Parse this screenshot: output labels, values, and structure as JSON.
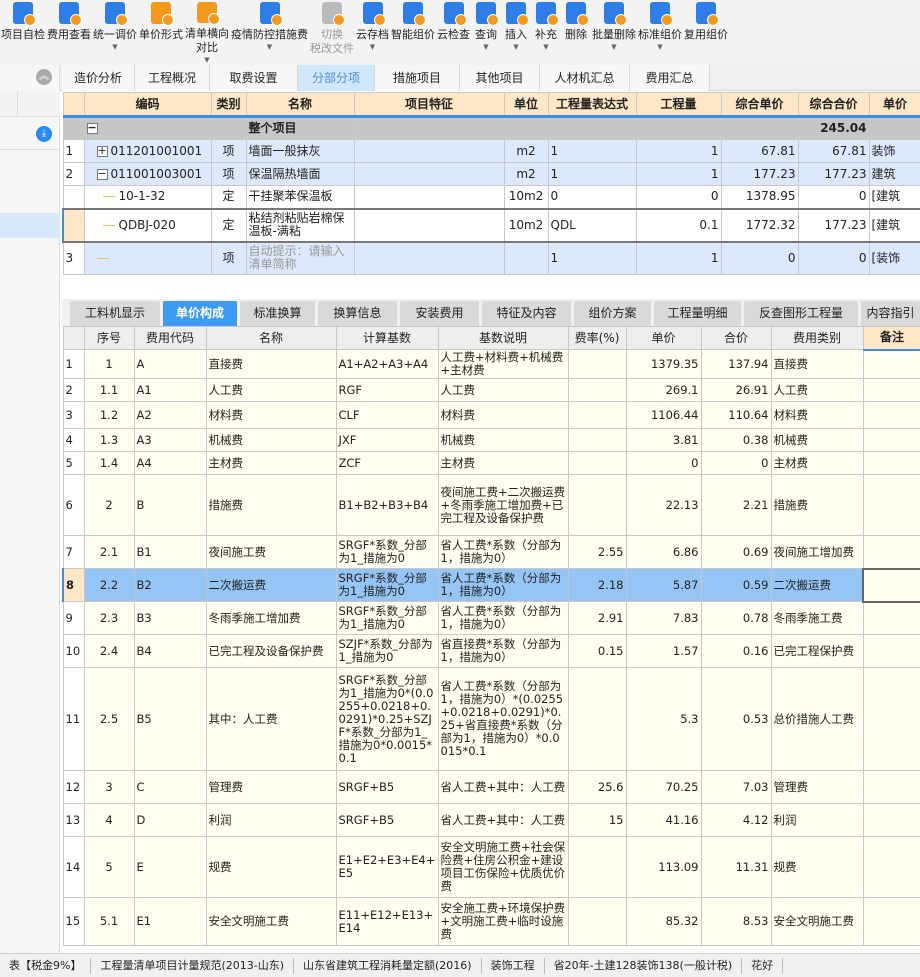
{
  "toolbar": [
    {
      "label": "项目自检",
      "icon": "check-doc-icon",
      "color": "#2f7ee8"
    },
    {
      "label": "费用查看",
      "icon": "fee-view-icon",
      "color": "#2f7ee8"
    },
    {
      "label": "统一调价",
      "icon": "adjust-price-icon",
      "color": "#2f7ee8",
      "dropdown": true
    },
    {
      "label": "单价形式",
      "icon": "price-form-icon",
      "color": "#f39a1e"
    },
    {
      "label": "清单横向",
      "label2": "对比",
      "icon": "compare-icon",
      "color": "#f39a1e",
      "dropdown": true
    },
    {
      "label": "疫情防控措施费",
      "icon": "epidemic-fee-icon",
      "color": "#2f7ee8",
      "dropdown": true
    },
    {
      "label": "切换",
      "label2": "税改文件",
      "icon": "switch-tax-icon",
      "color": "#bbbbbb",
      "disabled": true
    },
    {
      "label": "云存档",
      "icon": "cloud-upload-icon",
      "color": "#2f7ee8",
      "dropdown": true
    },
    {
      "label": "智能组价",
      "icon": "smart-price-icon",
      "color": "#2f7ee8"
    },
    {
      "label": "云检查",
      "icon": "cloud-check-icon",
      "color": "#2f7ee8"
    },
    {
      "label": "查询",
      "icon": "search-icon",
      "color": "#2f7ee8",
      "dropdown": true
    },
    {
      "label": "插入",
      "icon": "insert-icon",
      "color": "#2f7ee8",
      "dropdown": true
    },
    {
      "label": "补充",
      "icon": "add-icon",
      "color": "#2f7ee8",
      "dropdown": true
    },
    {
      "label": "删除",
      "icon": "trash-icon",
      "color": "#2f7ee8"
    },
    {
      "label": "批量删除",
      "icon": "batch-delete-icon",
      "color": "#2f7ee8",
      "dropdown": true
    },
    {
      "label": "标准组价",
      "icon": "standard-price-icon",
      "color": "#2f7ee8",
      "dropdown": true
    },
    {
      "label": "复用组价",
      "icon": "reuse-price-icon",
      "color": "#2f7ee8"
    }
  ],
  "main_tabs": [
    "造价分析",
    "工程概况",
    "取费设置",
    "分部分项",
    "措施项目",
    "其他项目",
    "人材机汇总",
    "费用汇总"
  ],
  "main_active": "分部分项",
  "upper": {
    "headers": [
      "编码",
      "类别",
      "名称",
      "项目特征",
      "单位",
      "工程量表达式",
      "工程量",
      "综合单价",
      "综合合价",
      "单价"
    ],
    "group": {
      "label": "整个项目",
      "total": "245.04"
    },
    "rows": [
      {
        "rn": "1",
        "code": "011201001001",
        "type": "项",
        "name": "墙面一般抹灰",
        "feature": "",
        "unit": "m2",
        "expr": "1",
        "qty": "1",
        "uprice": "67.81",
        "total": "67.81",
        "extra": "装饰",
        "box": "+"
      },
      {
        "rn": "2",
        "code": "011001003001",
        "type": "项",
        "name": "保温隔热墙面",
        "feature": "",
        "unit": "m2",
        "expr": "1",
        "qty": "1",
        "uprice": "177.23",
        "total": "177.23",
        "extra": "建筑",
        "box": "−"
      },
      {
        "rn": "",
        "code": "10-1-32",
        "type": "定",
        "name": "干挂聚苯保温板",
        "feature": "",
        "unit": "10m2",
        "expr": "0",
        "qty": "0",
        "uprice": "1378.95",
        "total": "0",
        "extra": "[建筑",
        "sub": true
      },
      {
        "rn": "",
        "code": "QDBJ-020",
        "type": "定",
        "name": "粘结剂粘贴岩棉保温板-满粘",
        "feature": "",
        "unit": "10m2",
        "expr": "QDL",
        "qty": "0.1",
        "uprice": "1772.32",
        "total": "177.23",
        "extra": "[建筑",
        "sub": true,
        "sel": true
      },
      {
        "rn": "3",
        "code": "",
        "type": "项",
        "name": "自动提示：请输入清单简称",
        "feature": "",
        "unit": "",
        "expr": "1",
        "qty": "1",
        "uprice": "0",
        "total": "0",
        "extra": "[装饰",
        "hint": true
      }
    ]
  },
  "bottom_tabs": [
    "工料机显示",
    "单价构成",
    "标准换算",
    "换算信息",
    "安装费用",
    "特征及内容",
    "组价方案",
    "工程量明细",
    "反查图形工程量",
    "内容指引"
  ],
  "bottom_active": "单价构成",
  "lower": {
    "headers": [
      "序号",
      "费用代码",
      "名称",
      "计算基数",
      "基数说明",
      "费率(%)",
      "单价",
      "合价",
      "费用类别",
      "备注"
    ],
    "rows": [
      [
        "1",
        "1",
        "A",
        "直接费",
        "A1+A2+A3+A4",
        "人工费+材料费+机械费+主材费",
        "",
        "1379.35",
        "137.94",
        "直接费"
      ],
      [
        "2",
        "1.1",
        "A1",
        "人工费",
        "RGF",
        "人工费",
        "",
        "269.1",
        "26.91",
        "人工费"
      ],
      [
        "3",
        "1.2",
        "A2",
        "材料费",
        "CLF",
        "材料费",
        "",
        "1106.44",
        "110.64",
        "材料费"
      ],
      [
        "4",
        "1.3",
        "A3",
        "机械费",
        "JXF",
        "机械费",
        "",
        "3.81",
        "0.38",
        "机械费"
      ],
      [
        "5",
        "1.4",
        "A4",
        "主材费",
        "ZCF",
        "主材费",
        "",
        "0",
        "0",
        "主材费"
      ],
      [
        "6",
        "2",
        "B",
        "措施费",
        "B1+B2+B3+B4",
        "夜间施工费+二次搬运费+冬雨季施工增加费+已完工程及设备保护费",
        "",
        "22.13",
        "2.21",
        "措施费"
      ],
      [
        "7",
        "2.1",
        "B1",
        "夜间施工费",
        "SRGF*系数_分部为1_措施为0",
        "省人工费*系数（分部为1，措施为0）",
        "2.55",
        "6.86",
        "0.69",
        "夜间施工增加费"
      ],
      [
        "8",
        "2.2",
        "B2",
        "二次搬运费",
        "SRGF*系数_分部为1_措施为0",
        "省人工费*系数（分部为1，措施为0）",
        "2.18",
        "5.87",
        "0.59",
        "二次搬运费"
      ],
      [
        "9",
        "2.3",
        "B3",
        "冬雨季施工增加费",
        "SRGF*系数_分部为1_措施为0",
        "省人工费*系数（分部为1，措施为0）",
        "2.91",
        "7.83",
        "0.78",
        "冬雨季施工费"
      ],
      [
        "10",
        "2.4",
        "B4",
        "已完工程及设备保护费",
        "SZJF*系数_分部为1_措施为0",
        "省直接费*系数（分部为1，措施为0）",
        "0.15",
        "1.57",
        "0.16",
        "已完工程保护费"
      ],
      [
        "11",
        "2.5",
        "B5",
        "其中：人工费",
        "SRGF*系数_分部为1_措施为0*(0.0255+0.0218+0.0291)*0.25+SZJF*系数_分部为1_措施为0*0.0015*0.1",
        "省人工费*系数（分部为1，措施为0）*(0.0255+0.0218+0.0291)*0.25+省直接费*系数（分部为1，措施为0）*0.0015*0.1",
        "",
        "5.3",
        "0.53",
        "总价措施人工费"
      ],
      [
        "12",
        "3",
        "C",
        "管理费",
        "SRGF+B5",
        "省人工费+其中：人工费",
        "25.6",
        "70.25",
        "7.03",
        "管理费"
      ],
      [
        "13",
        "4",
        "D",
        "利润",
        "SRGF+B5",
        "省人工费+其中：人工费",
        "15",
        "41.16",
        "4.12",
        "利润"
      ],
      [
        "14",
        "5",
        "E",
        "规费",
        "E1+E2+E3+E4+E5",
        "安全文明施工费+社会保险费+住房公积金+建设项目工伤保险+优质优价费",
        "",
        "113.09",
        "11.31",
        "规费"
      ],
      [
        "15",
        "5.1",
        "E1",
        "安全文明施工费",
        "E11+E12+E13+E14",
        "安全施工费+环境保护费+文明施工费+临时设施费",
        "",
        "85.32",
        "8.53",
        "安全文明施工费"
      ]
    ],
    "selected_row": "8"
  },
  "status": [
    "表【税金9%】",
    "工程量清单项目计量规范(2013-山东)",
    "山东省建筑工程消耗量定额(2016)",
    "装饰工程",
    "省20年-土建128装饰138(一般计税)",
    "花好"
  ]
}
